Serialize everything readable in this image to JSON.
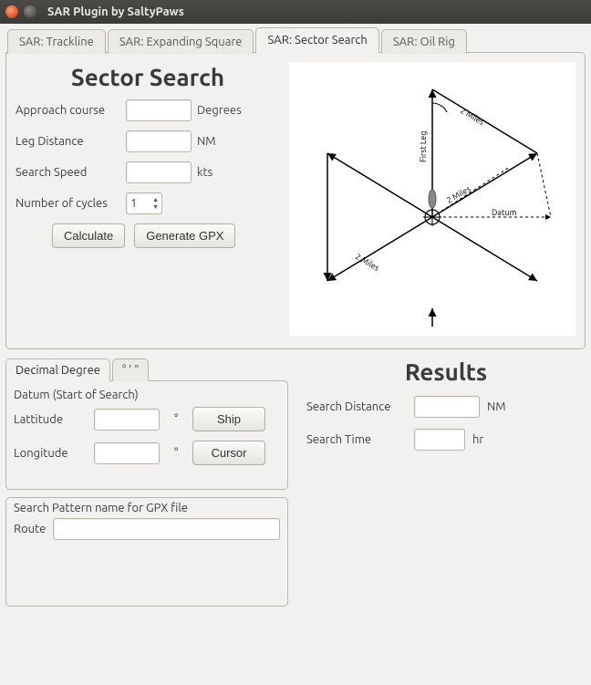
{
  "window": {
    "title": "SAR Plugin by SaltyPaws"
  },
  "tabs": [
    {
      "label": "SAR: Trackline",
      "active": false
    },
    {
      "label": "SAR: Expanding Square",
      "active": false
    },
    {
      "label": "SAR: Sector Search",
      "active": true
    },
    {
      "label": "SAR: Oil Rig",
      "active": false
    }
  ],
  "sector": {
    "title": "Sector Search",
    "fields": {
      "approach": {
        "label": "Approach course",
        "value": "",
        "unit": "Degrees"
      },
      "leg": {
        "label": "Leg Distance",
        "value": "",
        "unit": "NM"
      },
      "speed": {
        "label": "Search Speed",
        "value": "",
        "unit": "kts"
      },
      "cycles": {
        "label": "Number of cycles",
        "value": "1"
      }
    },
    "buttons": {
      "calculate": "Calculate",
      "gpx": "Generate GPX"
    }
  },
  "diagram": {
    "first_leg": "First Leg",
    "miles_a": "2 Miles",
    "miles_b": "2 Miles",
    "miles_c": "2 Miles",
    "datum": "Datum"
  },
  "datum": {
    "subtabs": {
      "decimal": "Decimal Degree",
      "dms": "° ' \""
    },
    "heading": "Datum (Start of Search)",
    "lat_label": "Lattitude",
    "lon_label": "Longitude",
    "deg_symbol": "°",
    "lat_value": "",
    "lon_value": "",
    "ship_btn": "Ship",
    "cursor_btn": "Cursor"
  },
  "gpx": {
    "heading": "Search Pattern name for GPX file",
    "route_label": "Route",
    "route_value": ""
  },
  "results": {
    "title": "Results",
    "distance": {
      "label": "Search Distance",
      "value": "",
      "unit": "NM"
    },
    "time": {
      "label": "Search Time",
      "value": "",
      "unit": "hr"
    }
  }
}
